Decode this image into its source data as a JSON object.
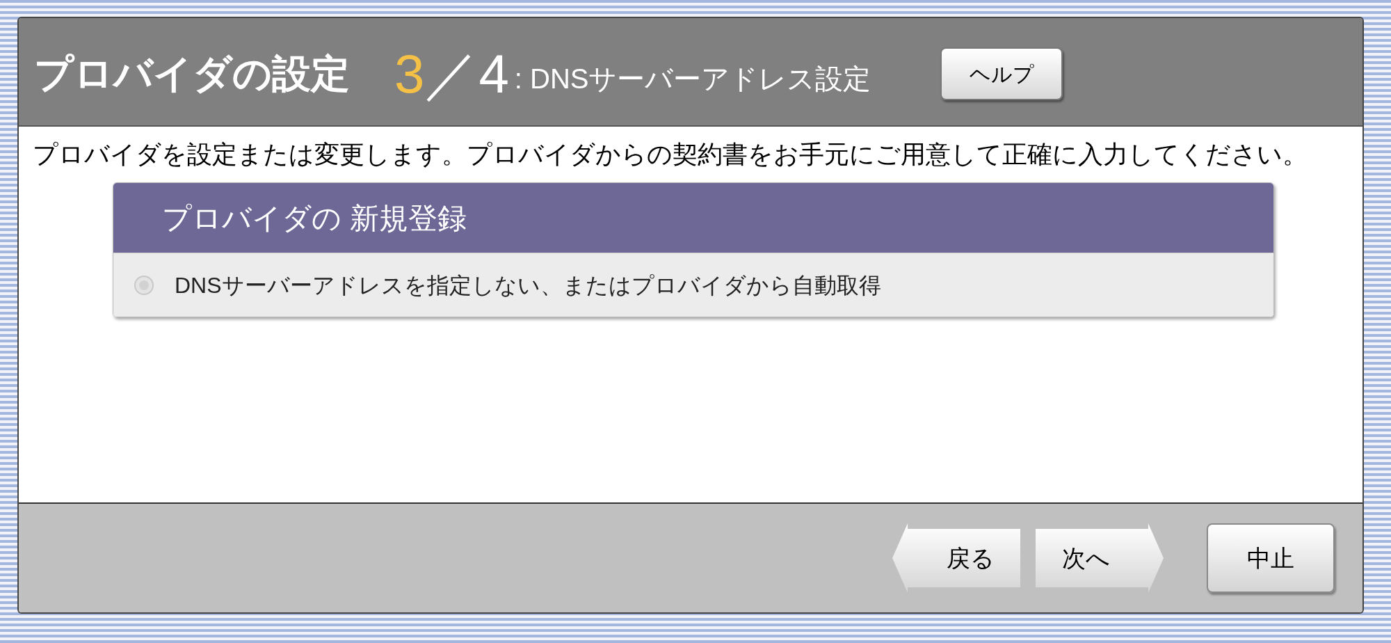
{
  "header": {
    "title": "プロバイダの設定",
    "step_current": "3",
    "step_total": "／4",
    "step_name": ": DNSサーバーアドレス設定",
    "help_button": "ヘルプ"
  },
  "description": "プロバイダを設定または変更します。プロバイダからの契約書をお手元にご用意して正確に入力してください。",
  "panel": {
    "title": "プロバイダの 新規登録",
    "options": [
      {
        "label": "DNSサーバーアドレスを指定しない、またはプロバイダから自動取得",
        "selected": false,
        "disabled": true
      }
    ]
  },
  "buttons": [
    {
      "label": "戻る",
      "kind": "back"
    },
    {
      "label": "次へ",
      "kind": "next"
    },
    {
      "label": "中止",
      "kind": "plain"
    }
  ]
}
